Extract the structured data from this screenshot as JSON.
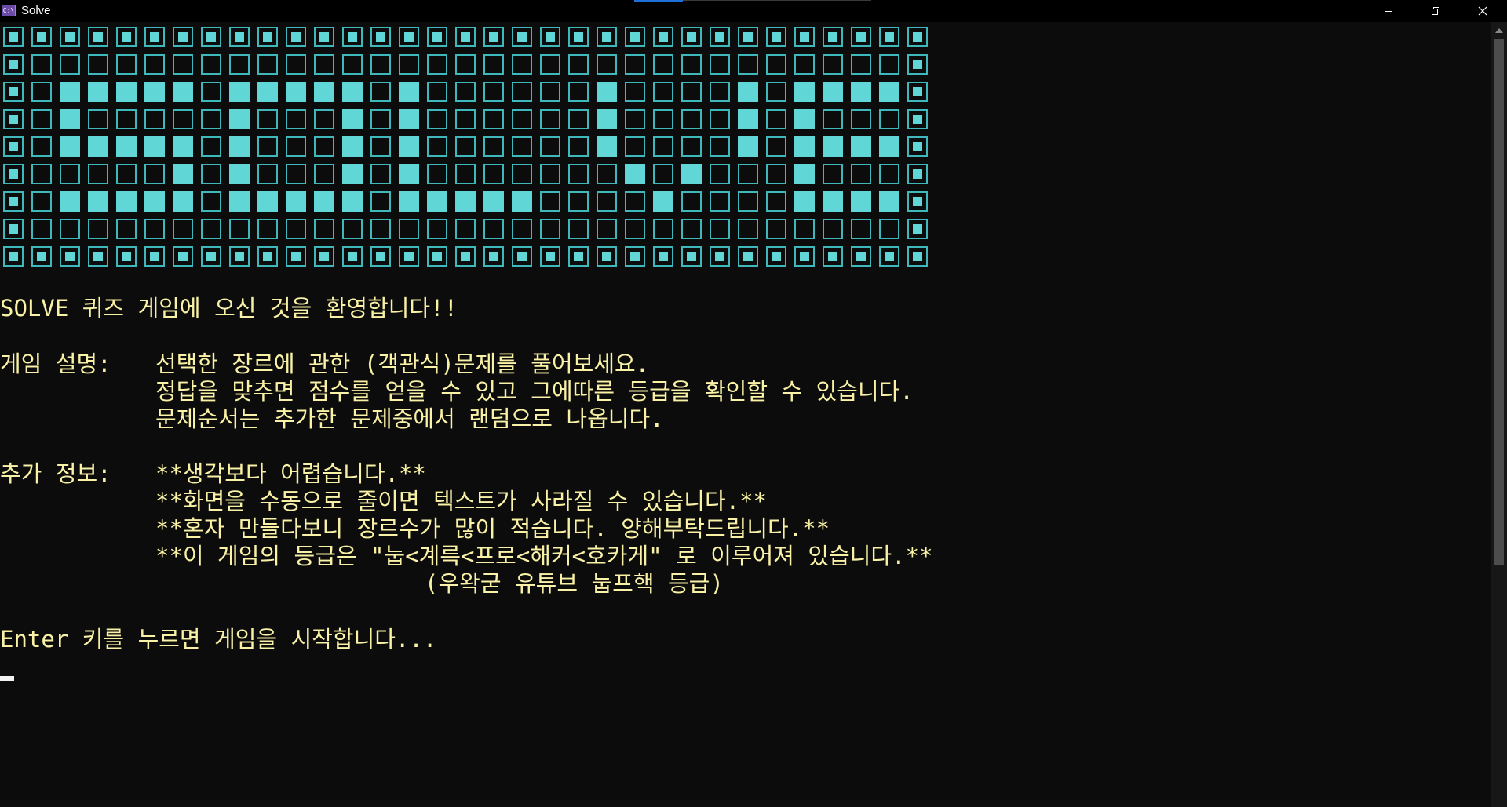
{
  "window": {
    "app_icon_text": "C:\\",
    "title": "Solve"
  },
  "banner": {
    "cols": 33,
    "rows": [
      "DDDDDDDDDDDDDDDDDDDDDDDDDDDDDDDDD",
      "D...............................D",
      "D.FFFFF.FFFFF.F......F....F.FFFFD",
      "D.F.....F...F.F......F....F.F...D",
      "D.FFFFF.F...F.F......F....F.FFFFD",
      "D.....F.F...F.F.......F.F...F...D",
      "D.FFFFF.FFFFF.FFFFF....F....FFFFD",
      "D...............................D",
      "DDDDDDDDDDDDDDDDDDDDDDDDDDDDDDDDD"
    ]
  },
  "console": {
    "welcome": "SOLVE 퀴즈 게임에 오신 것을 환영합니다!!",
    "desc_label": "게임 설명: ",
    "desc_lines": [
      "선택한 장르에 관한 (객관식)문제를 풀어보세요.",
      "정답을 맞추면 점수를 얻을 수 있고 그에따른 등급을 확인할 수 있습니다.",
      "문제순서는 추가한 문제중에서 랜덤으로 나옵니다."
    ],
    "info_label": "추가 정보: ",
    "info_lines": [
      "**생각보다 어렵습니다.**",
      "**화면을 수동으로 줄이면 텍스트가 사라질 수 있습니다.**",
      "**혼자 만들다보니 장르수가 많이 적습니다. 양해부탁드립니다.**",
      "**이 게임의 등급은 \"눕<계륵<프로<해커<호카게\" 로 이루어져 있습니다.**",
      "(우왁굳 유튜브 눕프핵 등급)"
    ],
    "prompt": "Enter 키를 누르면 게임을 시작합니다...",
    "text_color": "#f9f1a5",
    "banner_color": "#61d6d6"
  }
}
